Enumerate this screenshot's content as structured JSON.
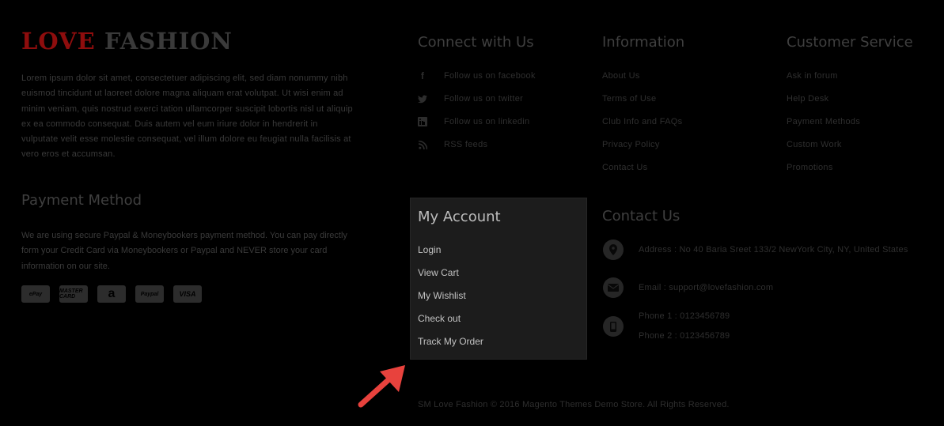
{
  "brand": {
    "word1": "LOVE",
    "word2": "FASHION"
  },
  "about_text": "Lorem ipsum dolor sit amet, consectetuer adipiscing elit, sed diam nonummy nibh euismod tincidunt ut laoreet dolore magna aliquam erat volutpat. Ut wisi enim ad minim veniam, quis nostrud exerci tation ullamcorper suscipit lobortis nisl ut aliquip ex ea commodo consequat. Duis autem vel eum iriure dolor in hendrerit in vulputate velit esse molestie consequat, vel illum dolore eu feugiat nulla facilisis at vero eros et accumsan.",
  "payment": {
    "title": "Payment Method",
    "text": "We are using secure Paypal & Moneybookers payment method. You can pay directly form your Credit Card via Moneybookers or Paypal and NEVER store your card information on our site.",
    "icons": [
      "ePay",
      "MASTER CARD",
      "a",
      "Paypal",
      "VISA"
    ]
  },
  "connect": {
    "title": "Connect with Us",
    "items": [
      {
        "label": "Follow us on facebook",
        "icon": "f"
      },
      {
        "label": "Follow us on twitter",
        "icon": "t"
      },
      {
        "label": "Follow us on linkedin",
        "icon": "in"
      },
      {
        "label": "RSS feeds",
        "icon": "rss"
      }
    ]
  },
  "information": {
    "title": "Information",
    "items": [
      "About Us",
      "Terms of Use",
      "Club Info and FAQs",
      "Privacy Policy",
      "Contact Us"
    ]
  },
  "customer_service": {
    "title": "Customer Service",
    "items": [
      "Ask in forum",
      "Help Desk",
      "Payment Methods",
      "Custom Work",
      "Promotions"
    ]
  },
  "account": {
    "title": "My Account",
    "items": [
      "Login",
      "View Cart",
      "My Wishlist",
      "Check out",
      "Track My Order"
    ]
  },
  "contact": {
    "title": "Contact Us",
    "address": "Address : No 40 Baria Sreet 133/2 NewYork City, NY, United States",
    "email": "Email : support@lovefashion.com",
    "phone1": "Phone 1 : 0123456789",
    "phone2": "Phone 2 : 0123456789"
  },
  "copyright": "SM Love Fashion © 2016 Magento Themes Demo Store. All Rights Reserved.",
  "colors": {
    "highlight_panel": "#1c1c1c",
    "arrow": "#e8423d",
    "brand_red": "#8e0d0d"
  }
}
